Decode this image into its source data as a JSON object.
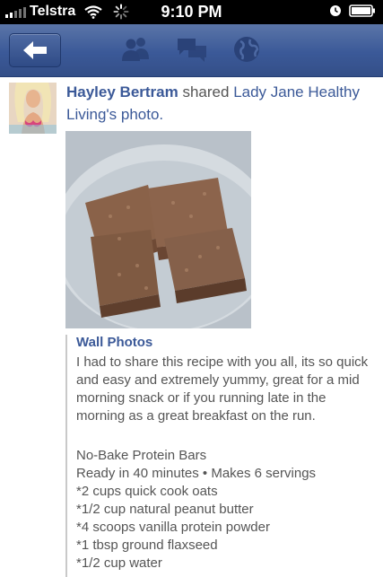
{
  "status_bar": {
    "carrier": "Telstra",
    "time": "9:10 PM"
  },
  "nav": {
    "icons": [
      "back-arrow-icon",
      "friends-icon",
      "messages-icon",
      "globe-icon"
    ]
  },
  "post": {
    "author": "Hayley Bertram",
    "action": " shared ",
    "source": "Lady Jane Healthy Living's",
    "object": " photo.",
    "album": "Wall Photos",
    "description": "I had to share this recipe with you all, its so quick and easy and extremely yummy, great for a mid morning snack or if you running late in the morning as a great breakfast on the run.",
    "recipe_lines": [
      "No-Bake Protein Bars",
      "Ready in 40 minutes • Makes 6 servings",
      "*2 cups quick cook oats",
      "*1/2 cup natural peanut butter",
      "*4 scoops vanilla protein powder",
      "*1 tbsp ground flaxseed",
      "*1/2 cup water"
    ]
  },
  "colors": {
    "brand": "#3b5998",
    "status_bar": "#000000",
    "text": "#555555"
  }
}
